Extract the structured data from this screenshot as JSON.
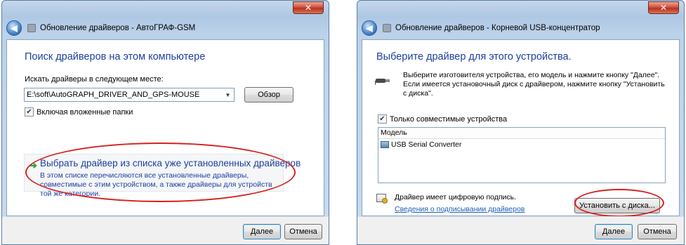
{
  "left_window": {
    "title": "Обновление драйверов - АвтоГРАФ-GSM",
    "heading": "Поиск драйверов на этом компьютере",
    "search_label": "Искать драйверы в следующем месте:",
    "path_value": "E:\\soft\\AutoGRAPH_DRIVER_AND_GPS-MOUSE",
    "browse_button": "Обзор",
    "include_subfolders": "Включая вложенные папки",
    "include_subfolders_checked": true,
    "option_title": "Выбрать драйвер из списка уже установленных драйверов",
    "option_description": "В этом списке перечисляются все установленные драйверы, совместимые с этим устройством, а также драйверы для устройств той же категории.",
    "next_button": "Далее",
    "cancel_button": "Отмена"
  },
  "right_window": {
    "title": "Обновление драйверов - Корневой USB-концентратор",
    "heading": "Выберите драйвер для этого устройства.",
    "intro_text": "Выберите изготовителя устройства, его модель и нажмите кнопку \"Далее\". Если имеется установочный диск с драйвером, нажмите кнопку \"Установить с диска\".",
    "compatible_only": "Только совместимые устройства",
    "compatible_only_checked": true,
    "list_header": "Модель",
    "models": [
      "USB Serial Converter"
    ],
    "signed_text": "Драйвер имеет цифровую подпись.",
    "signing_link": "Сведения о подписывании драйверов",
    "install_from_disk_button": "Установить с диска...",
    "next_button": "Далее",
    "cancel_button": "Отмена"
  },
  "colors": {
    "heading_blue": "#1e3f9e",
    "highlight_red": "#d6201f",
    "link_blue": "#1c5fb5"
  }
}
